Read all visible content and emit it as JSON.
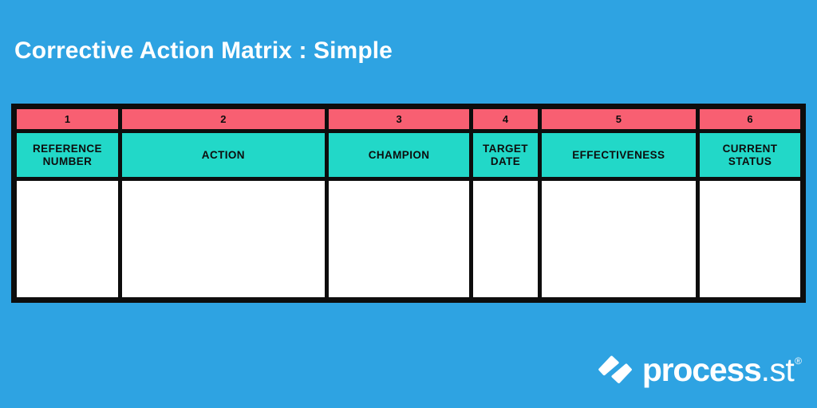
{
  "page": {
    "title": "Corrective Action Matrix : Simple",
    "background_color": "#2EA3E2"
  },
  "colors": {
    "background_blue": "#2EA3E2",
    "number_row_pink": "#F85F72",
    "header_row_teal": "#22D8C8",
    "body_cell_white": "#FFFFFF",
    "border_black": "#0D0D0D",
    "title_white": "#FFFFFF"
  },
  "matrix": {
    "column_numbers": [
      "1",
      "2",
      "3",
      "4",
      "5",
      "6"
    ],
    "column_headers": [
      "REFERENCE NUMBER",
      "ACTION",
      "CHAMPION",
      "TARGET DATE",
      "EFFECTIVENESS",
      "CURRENT STATUS"
    ],
    "body_rows": [
      [
        "",
        "",
        "",
        "",
        "",
        ""
      ]
    ]
  },
  "logo": {
    "mark_icon": "process-st-slashes-icon",
    "word_main": "process",
    "word_tld": ".st",
    "registered_mark": "®"
  }
}
